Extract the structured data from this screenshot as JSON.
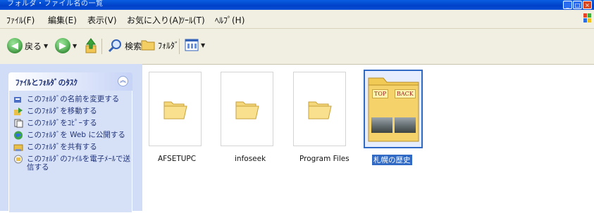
{
  "window": {
    "title": "フォルダ・ファイル名の一覧"
  },
  "menubar": {
    "items": [
      "ﾌｧｲﾙ(F)",
      "編集(E)",
      "表示(V)",
      "お気に入り(A)",
      "ﾂｰﾙ(T)",
      "ﾍﾙﾌﾟ(H)"
    ]
  },
  "toolbar": {
    "back": "戻る",
    "search": "検索",
    "folders": "ﾌｫﾙﾀﾞ"
  },
  "tasks": {
    "header": "ﾌｧｲﾙとﾌｫﾙﾀﾞのﾀｽｸ",
    "items": [
      "このﾌｫﾙﾀﾞの名前を変更する",
      "このﾌｫﾙﾀﾞを移動する",
      "このﾌｫﾙﾀﾞをｺﾋﾟｰする",
      "このﾌｫﾙﾀﾞを Web に公開する",
      "このﾌｫﾙﾀﾞを共有する",
      "このﾌｫﾙﾀﾞのﾌｧｲﾙを電子ﾒｰﾙで送信する"
    ]
  },
  "folders": [
    {
      "name": "AFSETUPC"
    },
    {
      "name": "infoseek"
    },
    {
      "name": "Program Files"
    },
    {
      "name": "札幌の歴史",
      "thumb_tags": [
        "TOP",
        "BACK"
      ]
    }
  ],
  "colors": {
    "title_bar": "#0a4fd6",
    "task_pane": "#d1dcf7",
    "selection": "#316ac5"
  }
}
